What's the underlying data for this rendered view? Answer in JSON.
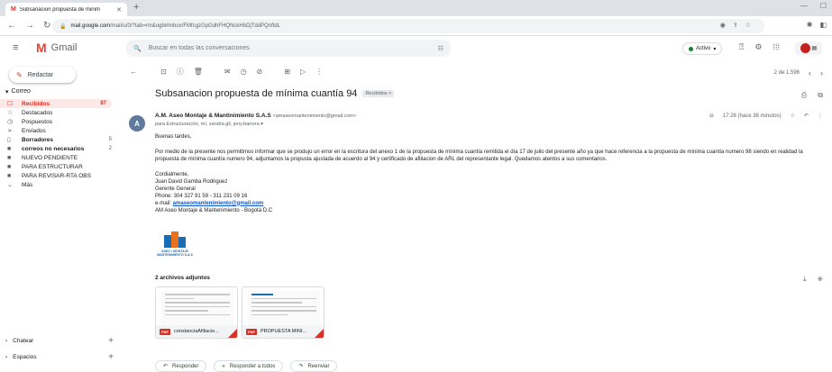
{
  "browser": {
    "tab_title": "Subsanacion propuesta de minim",
    "url_host": "mail.google.com",
    "url_path": "/mail/u/0/?tab=rm&ogbl#inbox/FMfcgzGpGdhFHQNckHbDjTddPQnftdL"
  },
  "gmail": {
    "app_name": "Gmail",
    "search_placeholder": "Buscar en todas las conversaciones",
    "status": "Activo",
    "compose_label": "Redactar"
  },
  "sidebar": {
    "section": "Correo",
    "items": [
      {
        "label": "Recibidos",
        "count": "87",
        "icon": "inbox-icon",
        "active": true,
        "bold": true
      },
      {
        "label": "Destacados",
        "count": "",
        "icon": "star-icon",
        "active": false,
        "bold": false
      },
      {
        "label": "Pospuestos",
        "count": "",
        "icon": "clock-icon",
        "active": false,
        "bold": false
      },
      {
        "label": "Enviados",
        "count": "",
        "icon": "send-icon",
        "active": false,
        "bold": false
      },
      {
        "label": "Borradores",
        "count": "5",
        "icon": "draft-icon",
        "active": false,
        "bold": true
      },
      {
        "label": "correos no necesarios",
        "count": "2",
        "icon": "label-icon",
        "active": false,
        "bold": true
      },
      {
        "label": "NUEVO PENDIENTE",
        "count": "",
        "icon": "label-icon",
        "active": false,
        "bold": false
      },
      {
        "label": "PARA ESTRUCTURAR",
        "count": "",
        "icon": "label-icon",
        "active": false,
        "bold": false
      },
      {
        "label": "PARA REVISAR-RTA OBS",
        "count": "",
        "icon": "label-icon",
        "active": false,
        "bold": false
      },
      {
        "label": "Más",
        "count": "",
        "icon": "chevron-down-icon",
        "active": false,
        "bold": false
      }
    ],
    "chat": "Chatear",
    "spaces": "Espacios"
  },
  "pager": {
    "text": "2 de 1.596"
  },
  "message": {
    "subject": "Subsanacion propuesta de mínima cuantía 94",
    "label_chip": "Recibidos ×",
    "sender_name": "A.M. Aseo Montaje & Mantinimiento S.A.S",
    "sender_email": "<amaseomantenimiento@gmail.com>",
    "recipients": "para Estructuración, mí, sandra.gil, jeny.barrera ▾",
    "time": "17:26 (hace 38 minutos)",
    "greeting": "Buenas tardes,",
    "paragraph": "Por medio de la presente nos permitimos informar que se produjo un error en la escritura del anexo 1 de la propuesta de mínima cuantía remitida el día 17 de julio del presente año  ya que hace referencia a la propuesta de mínima cuantía numero 98 siendo en realidad la propuesta de mínima cuantía numero 94, adjuntamos la propusta ajustada de acuerdo al 94 y certificado de afiliacion de ARL del representante legal. Quedamos atentos a sus comentarios.",
    "closing": "Cordialmente,",
    "sig_name": "Juan David Gamba Rodriguez",
    "sig_title": "Gerente General",
    "sig_phone": "Phone: 304 327 91 59 - 311 231 09 16",
    "sig_email_label": "e-mail: ",
    "sig_email": "amaseomantenimiento@gmail.com",
    "sig_company": "AM Aseo Montaje & Mantenimiento - Bogotá D.C",
    "logo_text": "ASEO • MONTAJE MANTENIMIENTO S.A.S"
  },
  "attachments": {
    "heading": "2 archivos adjuntos",
    "files": [
      {
        "name": "constanciaAfiliacio...",
        "type": "PDF"
      },
      {
        "name": "PROPUESTA MINI...",
        "type": "PDF"
      }
    ]
  },
  "actions": {
    "reply": "Responder",
    "reply_all": "Responder a todos",
    "forward": "Reenviar"
  }
}
